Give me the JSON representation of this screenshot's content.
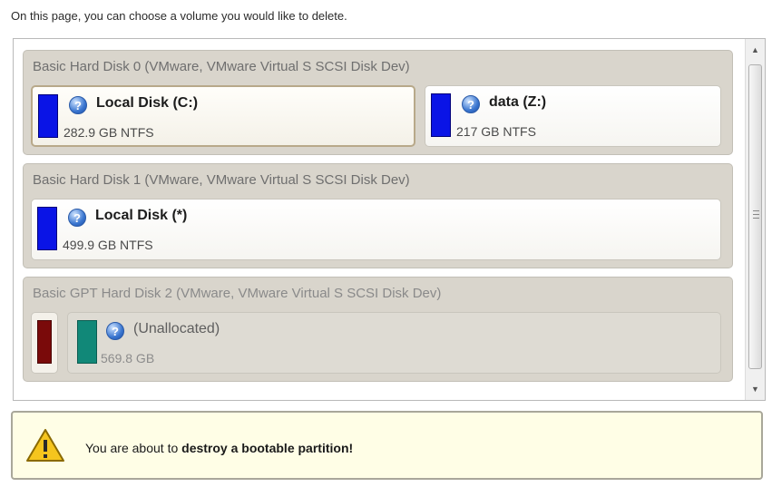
{
  "instruction": "On this page, you can choose a volume you would like to delete.",
  "disks": [
    {
      "title": "Basic Hard Disk 0 (VMware, VMware Virtual S SCSI Disk Dev)",
      "partitions": [
        {
          "name": "Local Disk (C:)",
          "size": "282.9 GB NTFS",
          "icon": "question-icon",
          "color": "#0a14e6",
          "selected": true
        },
        {
          "name": "data (Z:)",
          "size": "217 GB NTFS",
          "icon": "question-icon",
          "color": "#0a14e6",
          "selected": false
        }
      ]
    },
    {
      "title": "Basic Hard Disk 1 (VMware, VMware Virtual S SCSI Disk Dev)",
      "partitions": [
        {
          "name": "Local Disk (*)",
          "size": "499.9 GB NTFS",
          "icon": "question-icon",
          "color": "#0a14e6",
          "selected": false
        }
      ]
    },
    {
      "title": "Basic GPT Hard Disk 2 (VMware, VMware Virtual S SCSI Disk Dev)",
      "partitions": [
        {
          "name": "",
          "size": "",
          "icon": "",
          "color": "#7a0a0a",
          "selected": false
        },
        {
          "name": "(Unallocated)",
          "size": "569.8 GB",
          "icon": "question-icon",
          "color": "#118878",
          "selected": false
        }
      ]
    }
  ],
  "warning": {
    "icon": "warning-icon",
    "prefix": "You are about to ",
    "bold": "destroy a bootable partition!"
  },
  "scrollbar": {
    "up_icon": "arrow-up-icon",
    "down_icon": "arrow-down-icon"
  }
}
